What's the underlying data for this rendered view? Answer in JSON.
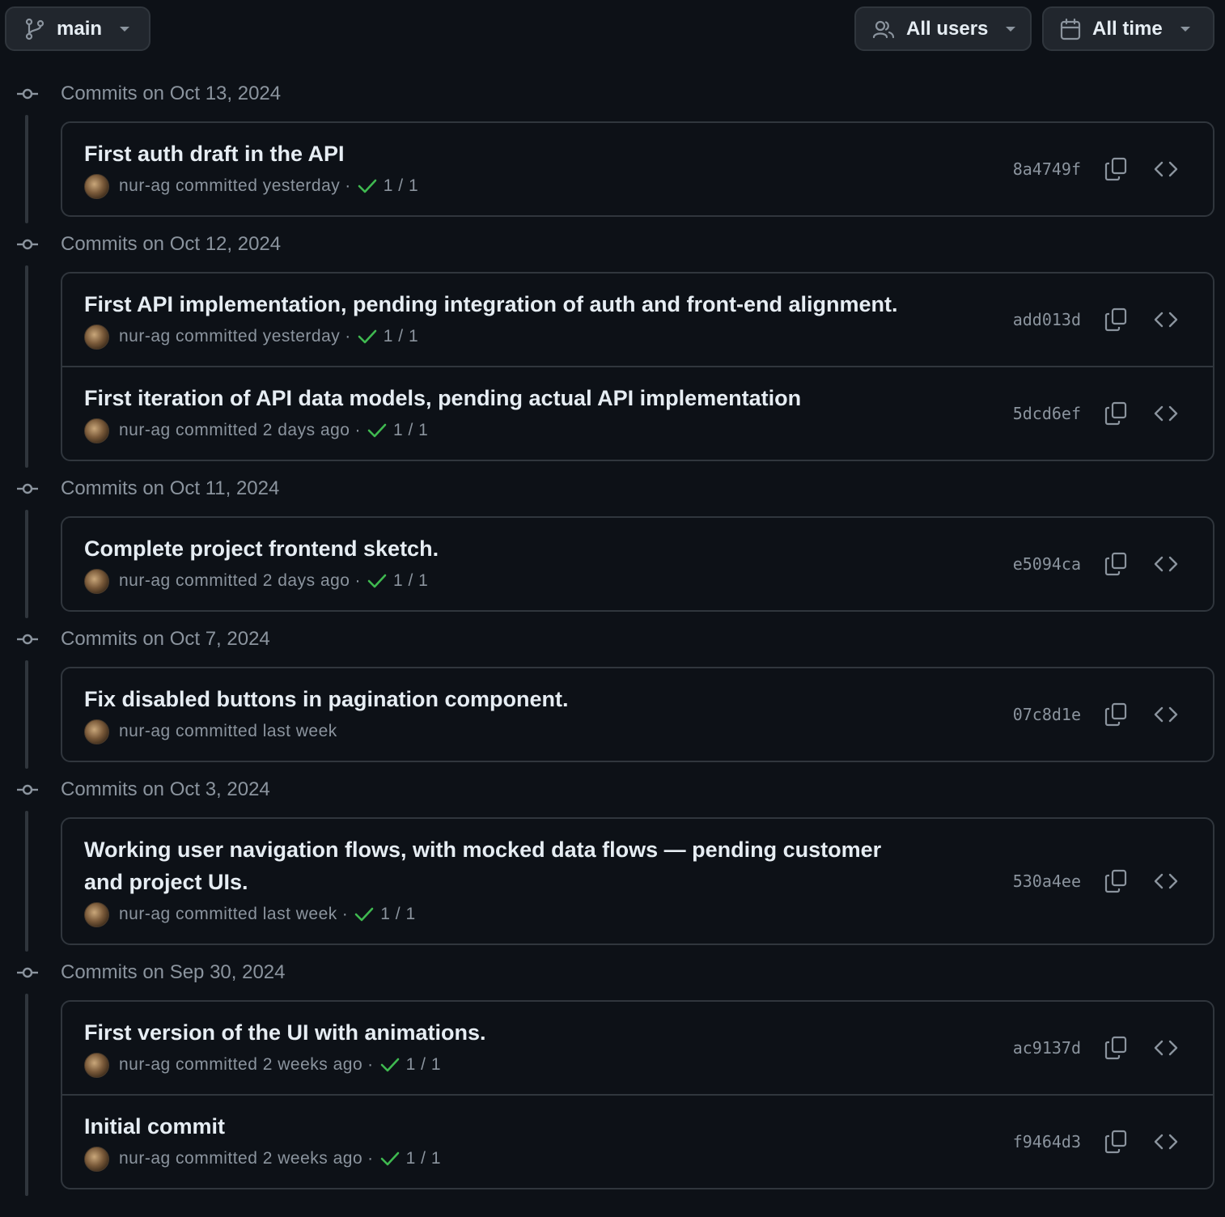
{
  "toolbar": {
    "branch_label": "main",
    "users_label": "All users",
    "time_label": "All time"
  },
  "groups": [
    {
      "date_label": "Commits on Oct 13, 2024",
      "commits": [
        {
          "title": "First auth draft in the API",
          "author": "nur-ag",
          "when": "committed yesterday",
          "checks": "1 / 1",
          "sha": "8a4749f"
        }
      ]
    },
    {
      "date_label": "Commits on Oct 12, 2024",
      "commits": [
        {
          "title": "First API implementation, pending integration of auth and front-end alignment.",
          "author": "nur-ag",
          "when": "committed yesterday",
          "checks": "1 / 1",
          "sha": "add013d"
        },
        {
          "title": "First iteration of API data models, pending actual API implementation",
          "author": "nur-ag",
          "when": "committed 2 days ago",
          "checks": "1 / 1",
          "sha": "5dcd6ef"
        }
      ]
    },
    {
      "date_label": "Commits on Oct 11, 2024",
      "commits": [
        {
          "title": "Complete project frontend sketch.",
          "author": "nur-ag",
          "when": "committed 2 days ago",
          "checks": "1 / 1",
          "sha": "e5094ca"
        }
      ]
    },
    {
      "date_label": "Commits on Oct 7, 2024",
      "commits": [
        {
          "title": "Fix disabled buttons in pagination component.",
          "author": "nur-ag",
          "when": "committed last week",
          "checks": "",
          "sha": "07c8d1e"
        }
      ]
    },
    {
      "date_label": "Commits on Oct 3, 2024",
      "commits": [
        {
          "title": "Working user navigation flows, with mocked data flows — pending customer and project UIs.",
          "author": "nur-ag",
          "when": "committed last week",
          "checks": "1 / 1",
          "sha": "530a4ee"
        }
      ]
    },
    {
      "date_label": "Commits on Sep 30, 2024",
      "commits": [
        {
          "title": "First version of the UI with animations.",
          "author": "nur-ag",
          "when": "committed 2 weeks ago",
          "checks": "1 / 1",
          "sha": "ac9137d"
        },
        {
          "title": "Initial commit",
          "author": "nur-ag",
          "when": "committed 2 weeks ago",
          "checks": "1 / 1",
          "sha": "f9464d3"
        }
      ]
    }
  ],
  "colors": {
    "background": "#0d1117",
    "border": "#30363d",
    "muted_text": "#8b949e",
    "success_check": "#3fb950"
  }
}
